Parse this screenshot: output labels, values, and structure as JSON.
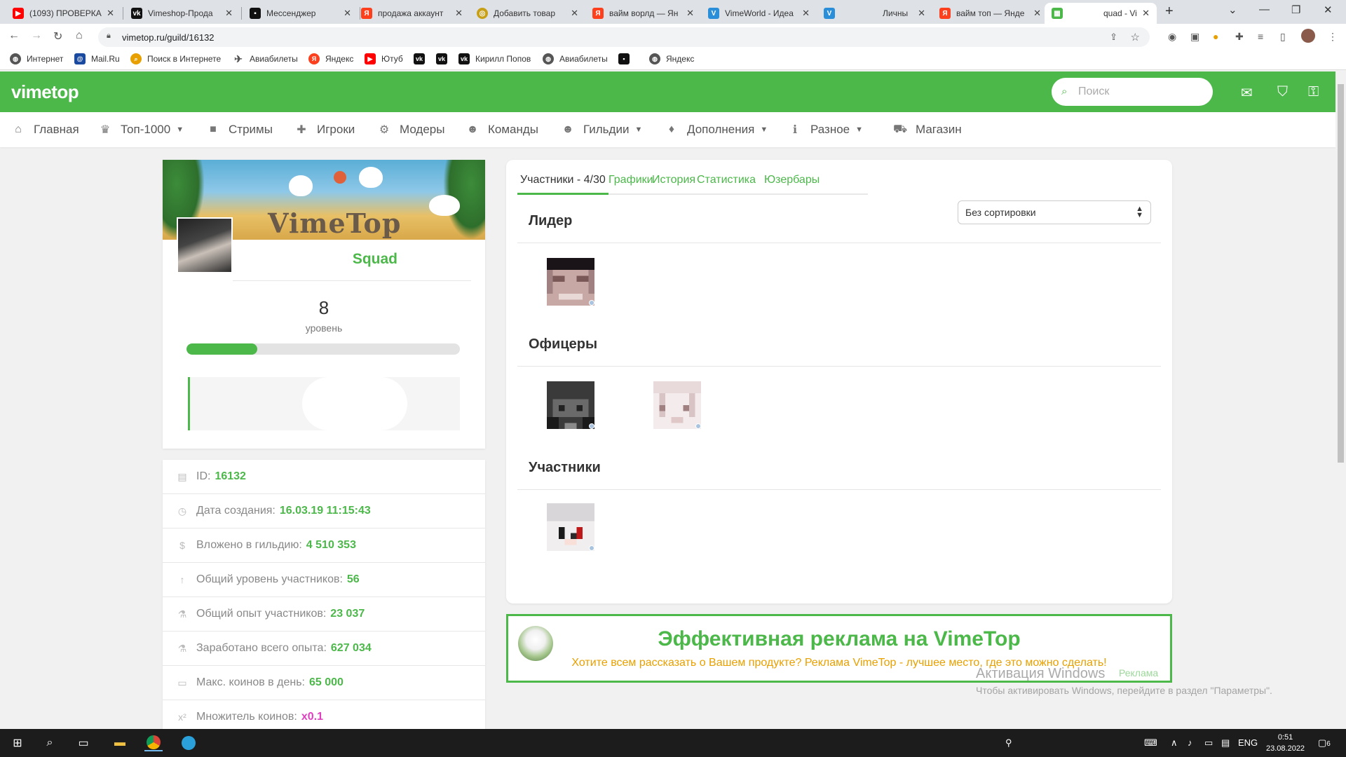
{
  "browser": {
    "tabs": [
      {
        "title": "(1093) ПРОВЕРКА",
        "icon": "youtube-icon",
        "color": "#ff0000"
      },
      {
        "title": "Vimeshop-Прода",
        "icon": "vk-icon",
        "color": "#111111"
      },
      {
        "title": "Мессенджер",
        "icon": "messenger-icon",
        "color": "#111111"
      },
      {
        "title": "продажа аккаунт",
        "icon": "yandex-icon",
        "color": "#fc3f1d"
      },
      {
        "title": "Добавить товар",
        "icon": "site-icon",
        "color": "#c8a018"
      },
      {
        "title": "вайм ворлд — Ян",
        "icon": "yandex-icon",
        "color": "#fc3f1d"
      },
      {
        "title": "VimeWorld - Идеа",
        "icon": "vimeworld-icon",
        "color": "#2a8fd8"
      },
      {
        "title": "Личны",
        "icon": "vimeworld-icon",
        "color": "#2a8fd8"
      },
      {
        "title": "вайм топ — Янде",
        "icon": "yandex-icon",
        "color": "#fc3f1d"
      },
      {
        "title": "quad - Vi",
        "icon": "vimetop-icon",
        "color": "#4cb84a"
      }
    ],
    "url": "vimetop.ru/guild/16132",
    "bookmarks": [
      {
        "label": "Интернет",
        "icon": "globe-icon"
      },
      {
        "label": "Mail.Ru",
        "icon": "mailru-icon"
      },
      {
        "label": "Поиск в Интернете",
        "icon": "search-icon"
      },
      {
        "label": "Авиабилеты",
        "icon": "plane-icon"
      },
      {
        "label": "Яндекс",
        "icon": "yandex-icon"
      },
      {
        "label": "Ютуб",
        "icon": "youtube-icon"
      },
      {
        "label": "",
        "icon": "vk-icon"
      },
      {
        "label": "",
        "icon": "vk-icon"
      },
      {
        "label": "Кирилл Попов",
        "icon": "vk-icon"
      },
      {
        "label": "Авиабилеты",
        "icon": "globe-icon"
      },
      {
        "label": "",
        "icon": "messenger-icon"
      },
      {
        "label": "Яндекс",
        "icon": "globe-icon"
      }
    ]
  },
  "site": {
    "logo": "vimetop",
    "search_placeholder": "Поиск",
    "accent": "#4cb84a",
    "nav": [
      {
        "label": "Главная",
        "icon": "home-icon",
        "dropdown": false
      },
      {
        "label": "Топ-1000",
        "icon": "trophy-icon",
        "dropdown": true
      },
      {
        "label": "Стримы",
        "icon": "video-icon",
        "dropdown": false
      },
      {
        "label": "Игроки",
        "icon": "user-plus-icon",
        "dropdown": false
      },
      {
        "label": "Модеры",
        "icon": "user-gear-icon",
        "dropdown": false
      },
      {
        "label": "Команды",
        "icon": "users-icon",
        "dropdown": false
      },
      {
        "label": "Гильдии",
        "icon": "users-icon",
        "dropdown": true
      },
      {
        "label": "Дополнения",
        "icon": "drop-icon",
        "dropdown": true
      },
      {
        "label": "Разное",
        "icon": "info-icon",
        "dropdown": true
      },
      {
        "label": "Магазин",
        "icon": "cart-icon",
        "dropdown": false
      }
    ]
  },
  "guild": {
    "banner_text": "VimeTop",
    "name": "Squad",
    "level": "8",
    "level_label": "уровень",
    "level_progress": 0.26,
    "links": [
      "https:",
      "https:"
    ],
    "stats": [
      {
        "label": "ID:",
        "value": "16132",
        "icon": "id-card-icon"
      },
      {
        "label": "Дата создания:",
        "value": "16.03.19 11:15:43",
        "icon": "clock-icon"
      },
      {
        "label": "Вложено в гильдию:",
        "value": "4 510 353",
        "icon": "dollar-icon"
      },
      {
        "label": "Общий уровень участников:",
        "value": "56",
        "icon": "level-up-icon"
      },
      {
        "label": "Общий опыт участников:",
        "value": "23 037",
        "icon": "flask-icon"
      },
      {
        "label": "Заработано всего опыта:",
        "value": "627 034",
        "icon": "flask-icon"
      },
      {
        "label": "Макс. коинов в день:",
        "value": "65 000",
        "icon": "money-icon"
      },
      {
        "label": "Множитель коинов:",
        "value": "x0.1",
        "icon": "superscript-icon"
      }
    ]
  },
  "members": {
    "tabs": [
      "Участники - 4/30",
      "Графики",
      "История",
      "Статистика",
      "Юзербары"
    ],
    "sort_selected": "Без сортировки",
    "sections": {
      "leader": "Лидер",
      "officers": "Офицеры",
      "participants": "Участники"
    }
  },
  "ad": {
    "title": "Эффективная реклама на VimeTop",
    "subtitle": "Хотите всем рассказать о Вашем продукте? Реклама VimeTop - лучшее место, где это можно сделать!",
    "corner": "Реклама"
  },
  "windows": {
    "activation_title": "Активация Windows",
    "activation_text": "Чтобы активировать Windows, перейдите в раздел \"Параметры\".",
    "lang": "ENG",
    "time": "0:51",
    "date": "23.08.2022",
    "notifications": "6"
  }
}
